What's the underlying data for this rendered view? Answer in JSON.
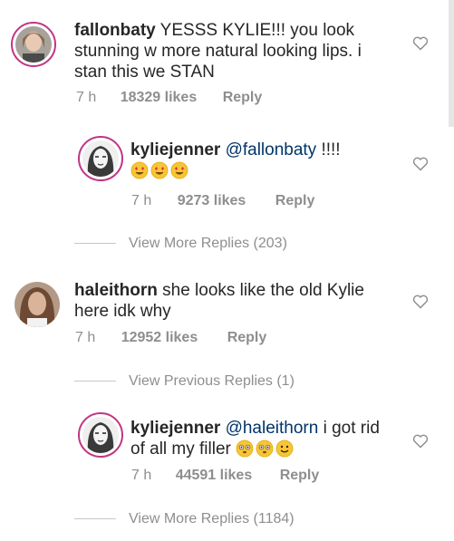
{
  "comments": [
    {
      "username": "fallonbaty",
      "text": "YESSS KYLIE!!! you look stunning w more natural looking lips. i stan this we STAN",
      "time": "7 h",
      "likes": "18329 likes",
      "reply": "Reply"
    },
    {
      "username": "kyliejenner",
      "mention": "@fallonbaty",
      "text": " !!!!",
      "emojis": [
        "heart-eyes",
        "heart-eyes",
        "heart-eyes"
      ],
      "time": "7 h",
      "likes": "9273 likes",
      "reply": "Reply"
    },
    {
      "username": "haleithorn",
      "text": "she looks like the old Kylie here idk why",
      "time": "7 h",
      "likes": "12952 likes",
      "reply": "Reply"
    },
    {
      "username": "kyliejenner",
      "mention": "@haleithorn",
      "text": " i got rid of all my filler",
      "emojis": [
        "flushed",
        "flushed",
        "slight-smile"
      ],
      "time": "7 h",
      "likes": "44591 likes",
      "reply": "Reply"
    }
  ],
  "threads": {
    "view_more_1": "View More Replies (203)",
    "view_previous": "View Previous Replies (1)",
    "view_more_2": "View More Replies (1184)"
  },
  "colors": {
    "text": "#262626",
    "meta": "#8e8e8e",
    "mention": "#003569",
    "story_ring": "#c13584"
  }
}
